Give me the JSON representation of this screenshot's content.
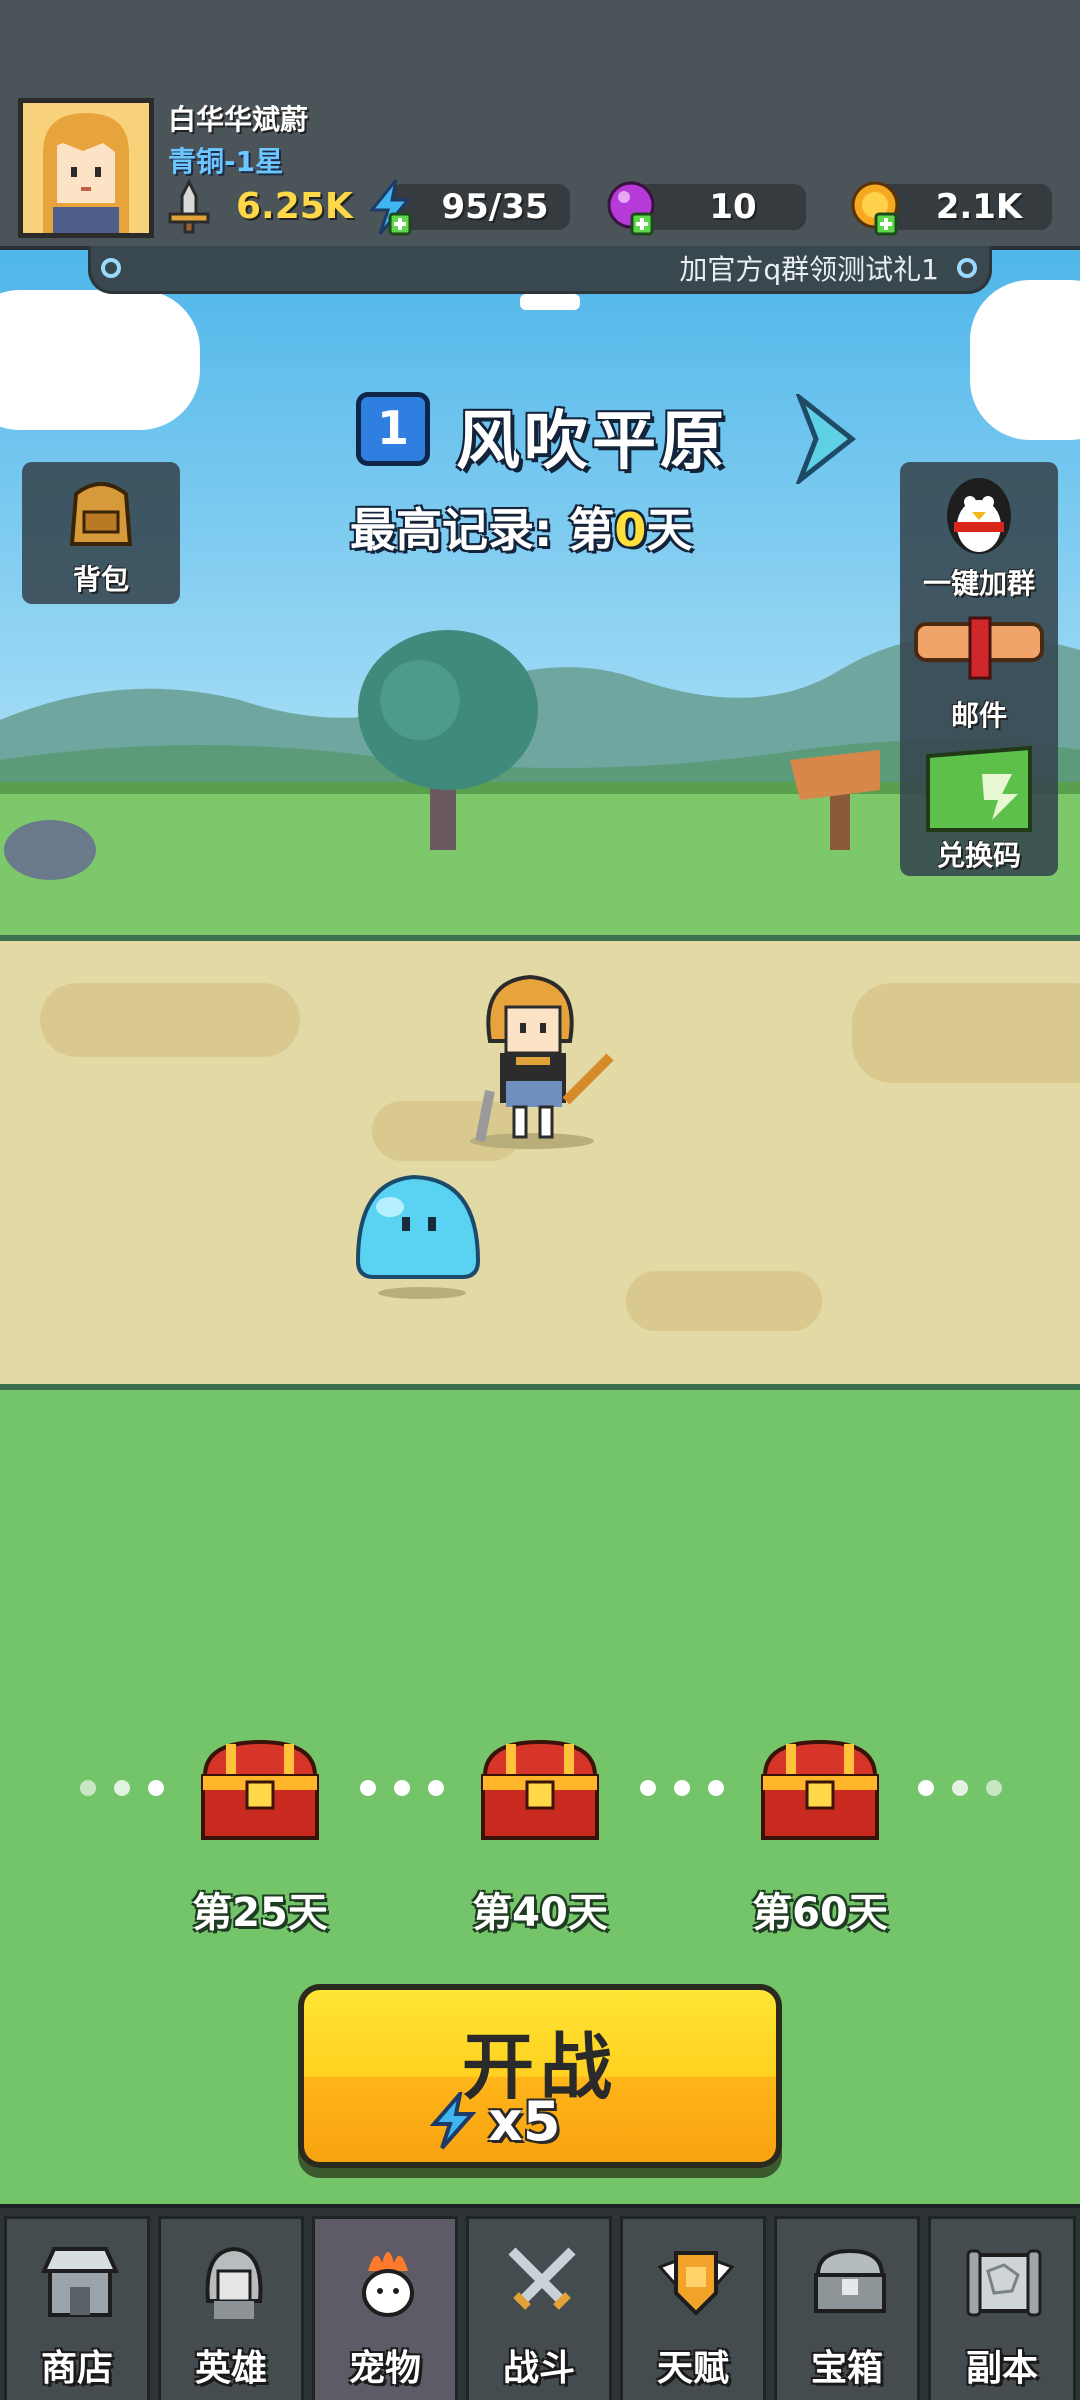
{
  "player": {
    "name": "白华华斌蔚",
    "rank": "青铜-1星",
    "power": "6.25K"
  },
  "resources": {
    "energy": "95/35",
    "gems": "10",
    "gold": "2.1K"
  },
  "notice": {
    "text": "加官方q群领测试礼1"
  },
  "stage": {
    "number": "1",
    "name": "风吹平原",
    "record_prefix": "最高记录: 第",
    "record_day": "0",
    "record_suffix": "天"
  },
  "side_left": {
    "bag_label": "背包"
  },
  "side_right": {
    "join_group_label": "一键加群",
    "mail_label": "邮件",
    "redeem_label": "兑换码"
  },
  "milestones": [
    {
      "label": "第25天"
    },
    {
      "label": "第40天"
    },
    {
      "label": "第60天"
    }
  ],
  "start": {
    "label": "开战",
    "cost": "x5"
  },
  "nav": [
    {
      "label": "商店",
      "icon": "shop-icon"
    },
    {
      "label": "英雄",
      "icon": "hero-icon"
    },
    {
      "label": "宠物",
      "icon": "pet-icon"
    },
    {
      "label": "战斗",
      "icon": "battle-icon"
    },
    {
      "label": "天赋",
      "icon": "talent-icon"
    },
    {
      "label": "宝箱",
      "icon": "chest-icon"
    },
    {
      "label": "副本",
      "icon": "dungeon-icon"
    }
  ],
  "colors": {
    "grass": "#74c469",
    "sky": "#4fb6e9",
    "road": "#e2d9a5",
    "start_button": "#ffd120",
    "rank_text": "#6cc6ff",
    "record_day": "#ffe03a"
  }
}
